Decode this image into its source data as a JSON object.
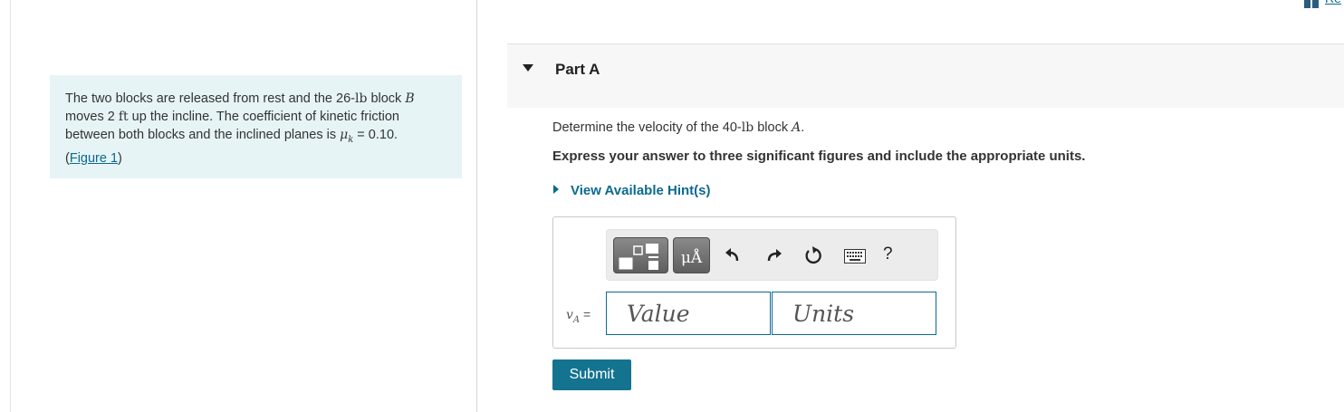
{
  "problem": {
    "text_1": "The two blocks are released from rest and the 26-",
    "unit_lb": "lb",
    "text_2": " block ",
    "block_b": "B",
    "text_3": "moves 2 ",
    "unit_ft": "ft",
    "text_4": " up the incline. The coefficient of kinetic friction between both blocks and the inclined planes is ",
    "mu_symbol": "μ",
    "mu_sub": "k",
    "text_5": " = 0.10.",
    "figure_link": "Figure 1"
  },
  "part": {
    "title": "Part A",
    "question_pre": "Determine the velocity of the 40-",
    "question_unit": "lb",
    "question_mid": " block ",
    "question_var": "A",
    "question_post": ".",
    "instructions": "Express your answer to three significant figures and include the appropriate units.",
    "hints_label": "View Available Hint(s)"
  },
  "answer": {
    "var_symbol": "v",
    "var_sub": "A",
    "equals": " =",
    "value_placeholder": "Value",
    "units_placeholder": "Units",
    "submit_label": "Submit"
  },
  "toolbar": {
    "units_label": "μÅ",
    "help_label": "?",
    "icons": [
      "templates-icon",
      "units-icon",
      "undo-icon",
      "redo-icon",
      "reset-icon",
      "keyboard-icon",
      "help-icon"
    ]
  },
  "topright": {
    "label": "Re"
  },
  "colors": {
    "accent": "#0c6a8e",
    "submit": "#14738f",
    "problem_bg": "#e6f4f6"
  }
}
